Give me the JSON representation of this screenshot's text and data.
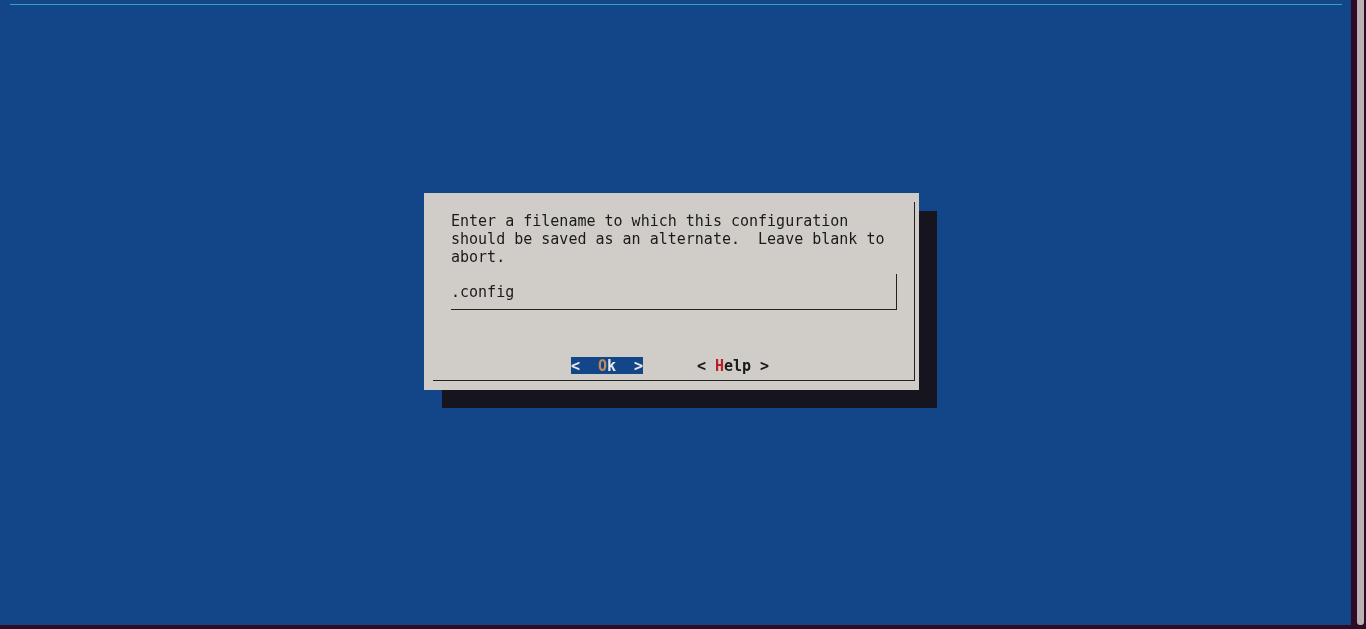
{
  "dialog": {
    "message": "Enter a filename to which this configuration should be saved as an alternate.  Leave blank to abort.",
    "input": {
      "value": ".config"
    },
    "buttons": [
      {
        "open": "<",
        "label": "Ok",
        "close": ">",
        "selected": true
      },
      {
        "open": "<",
        "label": "Help",
        "close": ">",
        "selected": false
      }
    ]
  }
}
